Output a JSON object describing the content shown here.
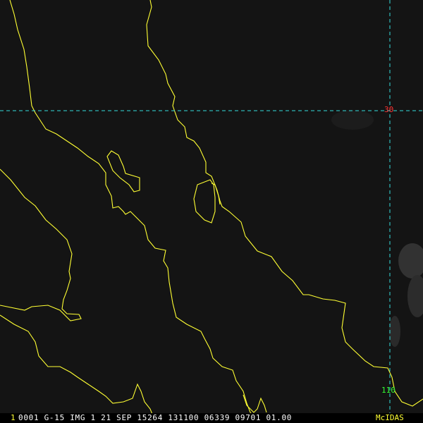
{
  "map": {
    "background": "#141414",
    "coastline_color": "#ffff33",
    "grid_color": "#33dddd",
    "graticule": {
      "latitude_label": "30",
      "latitude_label_color": "#ff3333",
      "longitude_label": "110",
      "longitude_label_color": "#33ff33"
    }
  },
  "status_bar": {
    "frame_number": "1",
    "frame_number_color": "#ffff33",
    "info_text": "0001 G-15 IMG    1 21 SEP 15264 131100 06339 09701 01.00",
    "info_color": "#ffffff",
    "brand": "McIDAS",
    "brand_color": "#ffff33"
  }
}
